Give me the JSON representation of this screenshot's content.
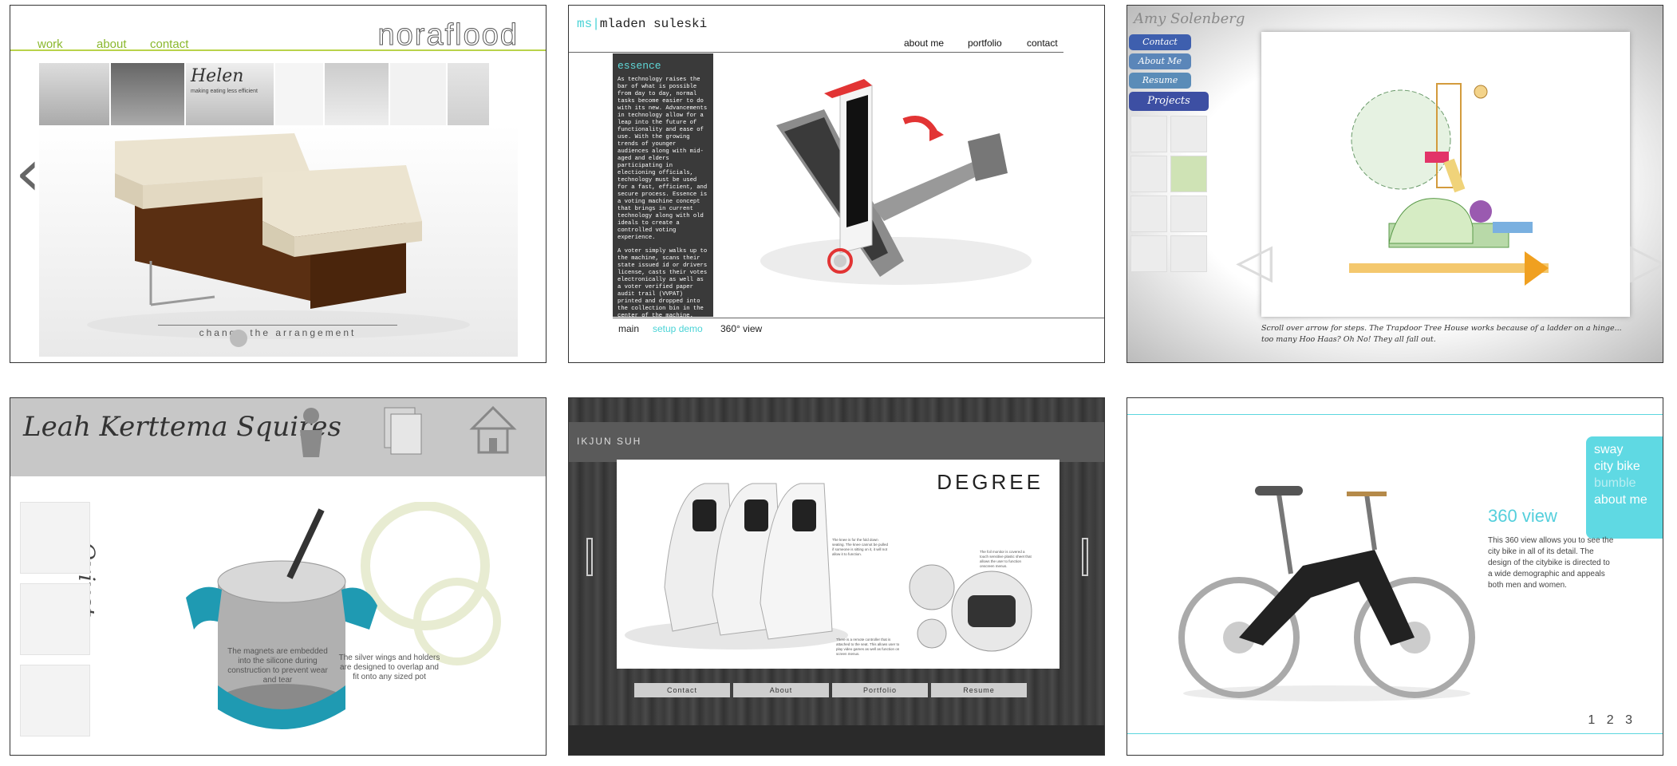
{
  "p1": {
    "nav": [
      "work",
      "about",
      "contact"
    ],
    "logo": "noraflood",
    "strip_label": "Helen",
    "strip_sub": "making eating less efficient",
    "slider_label": "change the arrangement",
    "colors": {
      "accent": "#b9d34a",
      "nav": "#8ab82d"
    }
  },
  "p2": {
    "brand_ms": "ms",
    "brand_sep": "|",
    "brand_name": "mladen suleski",
    "menu": [
      "about me",
      "portfolio",
      "contact"
    ],
    "essence_title": "essence",
    "essence_p1": "As technology raises the bar of what is possible from day to day, normal tasks become easier to do with its new. Advancements in technology allow for a leap into the future of functionality and ease of use. With the growing trends of younger audiences along with mid-aged and elders participating in electioning officials, technology must be used for a fast, efficient, and secure process. Essence is a voting machine concept that brings in current technology along with old ideals to create a controlled voting experience.",
    "essence_p2": "A voter simply walks up to the machine, scans their state issued id or drivers license, casts their votes electronically as well as a voter verified paper audit trail (VVPAT) printed and dropped into the collection bin in the center of the machine.",
    "bottom": [
      "main",
      "setup demo",
      "360° view"
    ],
    "colors": {
      "accent": "#4ad3d6"
    }
  },
  "p3": {
    "name": "Amy Solenberg",
    "buttons": [
      "Contact",
      "About Me",
      "Resume",
      "Projects"
    ],
    "caption": "Scroll over arrow for steps. The Trapdoor Tree House works because of a ladder on a hinge... too many Hoo Haas? Oh No! They all fall out."
  },
  "p4": {
    "signature": "Leah Kerttema Squires",
    "vertical_title": "Quivet",
    "note1": "The magnets are embedded into the silicone during construction to prevent wear and tear",
    "note2": "The silver wings and holders are designed to overlap and fit onto any sized pot"
  },
  "p5": {
    "brand": "IKJUN SUH",
    "title": "DEGREE",
    "menu": [
      "Contact",
      "About",
      "Portfolio",
      "Resume"
    ],
    "note1": "The knee is for the fold down seating. The knee cannot be pulled if someone is sitting on it, it will not allow it to function.",
    "note2": "The foil monitor is covered a touch sensitive plastic sheet that allows the user to function onscreen menus.",
    "note3": "There is a remote controller that is attached to the seat. This allows user to play video games as well as function on screen menus."
  },
  "p6": {
    "menu": [
      "sway",
      "city bike",
      "bumble",
      "about me"
    ],
    "heading": "360 view",
    "description": "This 360 view allows you to see the city bike in all of its detail. The design of the citybike is directed to a wide demographic and appeals both men and women.",
    "pages": [
      "1",
      "2",
      "3"
    ],
    "colors": {
      "accent": "#5fd9e3"
    }
  }
}
